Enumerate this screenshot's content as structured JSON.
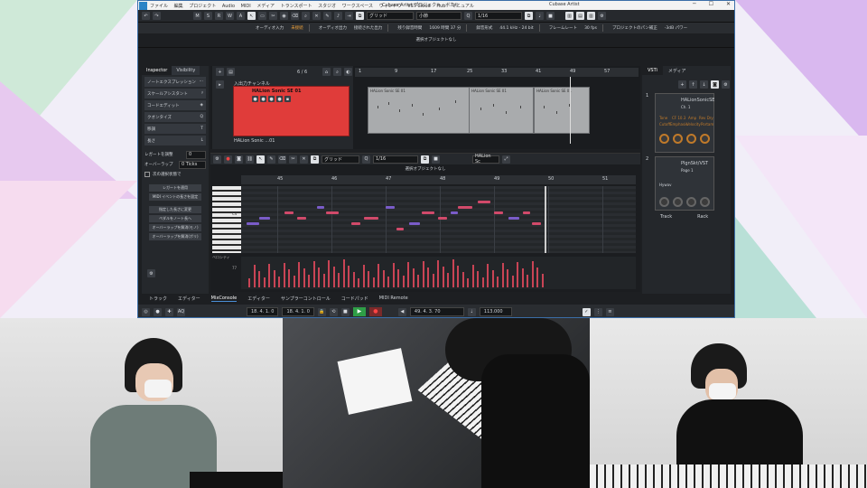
{
  "window": {
    "title": "Cubase Artist プロジェクト - ボカル",
    "app_name": "Cubase Artist"
  },
  "menu": [
    "ファイル",
    "編集",
    "プロジェクト",
    "Audio",
    "MIDI",
    "メディア",
    "トランスポート",
    "スタジオ",
    "ワークスペース",
    "ウィンドウ",
    "VST Cloud",
    "Hub",
    "マニュアル"
  ],
  "toolbar": {
    "mode_buttons": [
      "M",
      "S",
      "R",
      "W",
      "A"
    ],
    "snap": "グリッド",
    "quantize_unit": "小節",
    "length": "1/16"
  },
  "info": {
    "audio_input": "オーディオ入力",
    "unconnected": "未接続",
    "audio_output": "オーディオ出力",
    "connected": "接続された出力",
    "max_record_time": "残り録音時間",
    "record_time_value": "1609 時間 37 分",
    "record_format": "録音形式",
    "format_value": "44.1 kHz - 24 bit",
    "frame_rate": "フレームレート",
    "fps_value": "30 fps",
    "pan_law": "プロジェクトのパン補正",
    "pan_value": "-3dB パワー"
  },
  "selection_text": "選択オブジェクトなし",
  "inspector": {
    "tabs": [
      "Inspector",
      "Visibility"
    ],
    "sections": [
      "ノートエクスプレッション",
      "スケールアシスタント",
      "コードエディット",
      "クオンタイズ",
      "移調",
      "長さ"
    ],
    "legato_label": "レガートを調整",
    "legato_value": "0",
    "overlap_label": "オーバーラップ",
    "overlap_value": "0 Ticks",
    "selected_only": "次の選択状態で",
    "buttons": [
      "レガートを適用",
      "MIDI イベントの長さを固定",
      "指定した長さに変更",
      "ペダルをノート長へ",
      "オーバーラップを解消(モノ)",
      "オーバーラップを解消(ポリ)"
    ]
  },
  "project": {
    "track_count": "6 / 6",
    "folder_label": "入出力チャンネル",
    "track_name": "HALion Sonic SE 01",
    "track_name_short": "HALion Sonic ...01",
    "ruler_labels": [
      "1",
      "9",
      "17",
      "25",
      "33",
      "41",
      "49",
      "57"
    ],
    "parts": [
      "HALion Sonic SE 01",
      "HALion Sonic SE 01",
      "HALion Sonic SE 01"
    ]
  },
  "editor": {
    "snap": "グリッド",
    "quantize": "1/16",
    "instrument": "HALion Sc",
    "ruler_labels": [
      "45",
      "46",
      "47",
      "48",
      "49",
      "50",
      "51"
    ],
    "key_label": "C4",
    "velocity_lane": "ベロシティ",
    "velocity_value": "77"
  },
  "vsti": {
    "tabs": [
      "VSTi",
      "メディア"
    ],
    "slot1": {
      "number": "1",
      "name": "HALionSonicSE",
      "sub": "Ch. 1",
      "params": [
        "Tone",
        "CF 10.3",
        "Amp",
        "Rev Dry",
        "Cutoff",
        "Emphasis",
        "Velocity",
        "Portam"
      ]
    },
    "slot2": {
      "number": "2",
      "name": "PlgnSkt/VST",
      "sub": "Page 1",
      "extra": "Hywav"
    },
    "footer": [
      "Track",
      "Rack"
    ]
  },
  "bottom_tabs": [
    "トラック",
    "エディター",
    "MixConsole",
    "エディター",
    "サンプラーコントロール",
    "コードパッド",
    "MIDI Remote"
  ],
  "transport": {
    "left_locator": "18. 4. 1. 0",
    "right_locator": "18. 4. 1. 0",
    "position": "49. 4. 3. 70",
    "tempo": "113.000"
  },
  "colors": {
    "track_red": "#e03c3a",
    "note_purple": "#7a5cc8",
    "note_pink": "#d14a6a",
    "accent_blue": "#2c84c6"
  }
}
